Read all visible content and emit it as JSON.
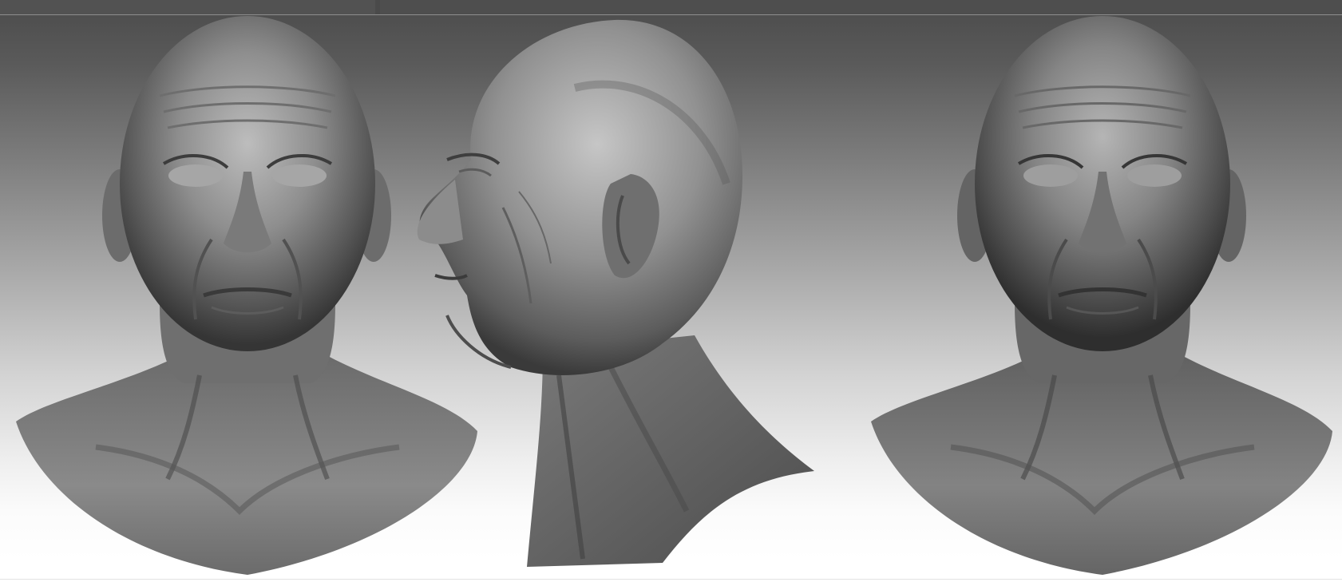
{
  "window": {
    "title": ""
  },
  "renders": [
    {
      "view": "front",
      "icon": "sculpted-bust-front-icon"
    },
    {
      "view": "profile-left",
      "icon": "sculpted-bust-profile-icon"
    },
    {
      "view": "front-alt",
      "icon": "sculpted-bust-front-icon"
    }
  ],
  "colors": {
    "background_top": "#4b4b4b",
    "background_bottom": "#ffffff",
    "clay": "#8a8a8a",
    "clay_highlight": "#c9c9c9",
    "clay_shadow": "#2e2e2e"
  }
}
